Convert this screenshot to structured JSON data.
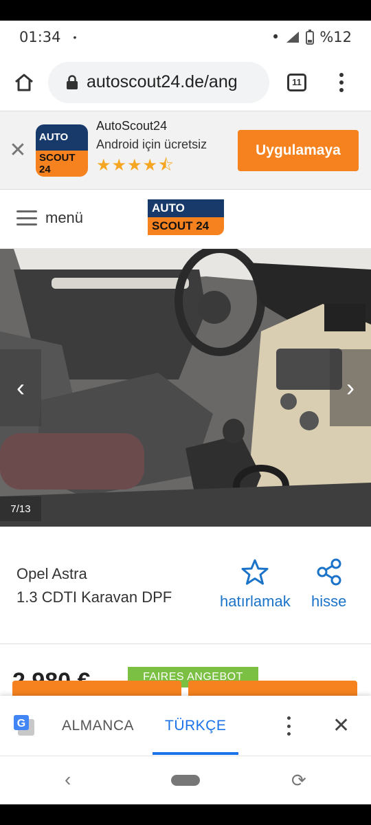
{
  "status_bar": {
    "time": "01:34",
    "dot": "•",
    "notif_dot": "•",
    "battery": "%12"
  },
  "browser": {
    "url": "autoscout24.de/ang",
    "tab_count": "11"
  },
  "app_banner": {
    "close": "✕",
    "icon_top": "AUTO",
    "icon_bottom": "SCOUT 24",
    "name": "AutoScout24",
    "subtitle": "Android için ücretsiz",
    "stars": "★★★★⯪",
    "rating": 4.5,
    "install_label": "Uygulamaya"
  },
  "site_header": {
    "menu_label": "menü",
    "logo_top": "AUTO",
    "logo_bottom": "SCOUT 24"
  },
  "gallery": {
    "prev": "‹",
    "next": "›",
    "counter": "7/13"
  },
  "listing": {
    "title_line1": "Opel Astra",
    "title_line2": "1.3 CDTI Karavan DPF",
    "remember_label": "hatırlamak",
    "share_label": "hisse",
    "price_partial": "2.980 €",
    "badge": "FAIRES ANGEBOT"
  },
  "translate_bar": {
    "source_lang": "ALMANCA",
    "target_lang": "TÜRKÇE",
    "close": "✕"
  },
  "system_nav": {
    "back": "‹",
    "rotate": "⟳"
  },
  "colors": {
    "brand_orange": "#f5821f",
    "brand_blue": "#173a6b",
    "link_blue": "#1a73c8",
    "badge_green": "#7bc043"
  }
}
